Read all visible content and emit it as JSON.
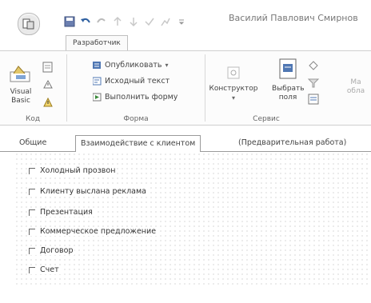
{
  "window": {
    "title": "Василий Павлович Смирнов"
  },
  "ribbon": {
    "active_tab": "Разработчик",
    "groups": {
      "code": {
        "label": "Код",
        "visual_basic_line1": "Visual",
        "visual_basic_line2": "Basic"
      },
      "form": {
        "label": "Форма",
        "publish": "Опубликовать",
        "source_text": "Исходный текст",
        "run_form": "Выполнить форму"
      },
      "service": {
        "label": "Сервис",
        "designer": "Конструктор",
        "choose_fields_line1": "Выбрать",
        "choose_fields_line2": "поля",
        "cut_line1": "Ма",
        "cut_line2": "обла"
      }
    }
  },
  "form": {
    "tabs": [
      {
        "label": "Общие"
      },
      {
        "label": "Взаимодействие с клиентом"
      },
      {
        "label": "(Предварительная работа)"
      }
    ],
    "active_tab_index": 1,
    "checkboxes": [
      {
        "label": "Холодный прозвон",
        "checked": false
      },
      {
        "label": "Клиенту выслана реклама",
        "checked": false
      },
      {
        "label": "Презентация",
        "checked": false
      },
      {
        "label": "Коммерческое предложение",
        "checked": false
      },
      {
        "label": "Договор",
        "checked": false
      },
      {
        "label": "Счет",
        "checked": false
      }
    ]
  }
}
